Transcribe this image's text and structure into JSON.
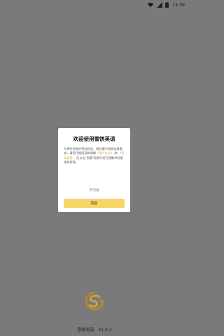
{
  "status_bar": {
    "time": "11:39"
  },
  "dialog": {
    "title": "欢迎使用雪饼英语",
    "body_line_1": "为更好地保护您的权益，同时遵守相关监管要求，请您仔细阅读和理解",
    "privacy_link": "《用户协议》",
    "and_text": " 和 ",
    "terms_link": "《隐私政策》",
    "body_line_2": " 后点击\"同意\"即表示您已理解并同意相关条款。",
    "disagree_label": "不同意",
    "agree_label": "同意"
  },
  "splash": {
    "app_name": "雪饼英语",
    "version": "V1.0.3"
  },
  "colors": {
    "overlay": "#7a7a7a",
    "accent": "#f7d468",
    "link": "#d9b24a"
  }
}
